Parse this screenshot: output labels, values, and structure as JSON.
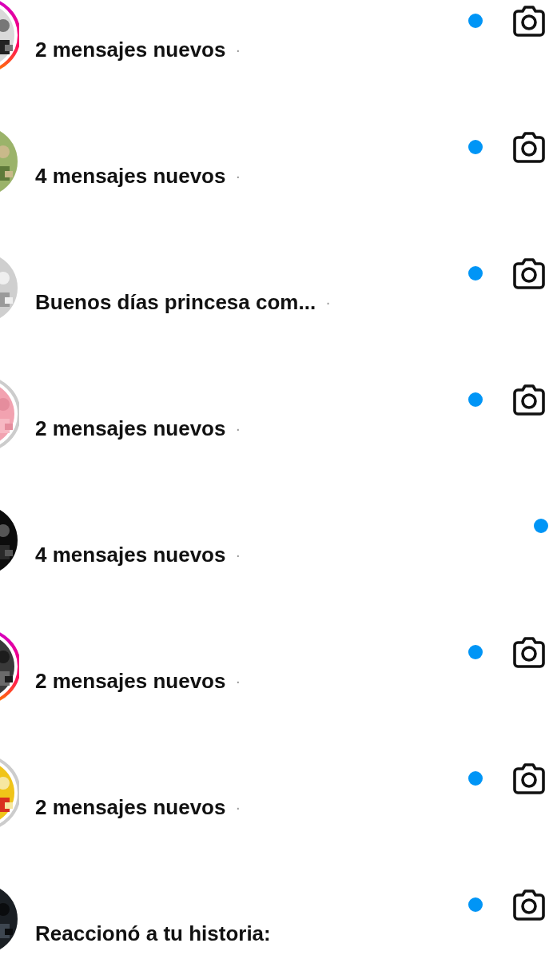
{
  "chats": [
    {
      "story_ring": true,
      "story_seen": false,
      "preview": "2 mensajes nuevos",
      "separator": "·",
      "unread": true,
      "camera": true
    },
    {
      "story_ring": false,
      "preview": "4 mensajes nuevos",
      "separator": "·",
      "unread": true,
      "camera": true
    },
    {
      "story_ring": false,
      "preview": "Buenos días princesa com...",
      "separator": "·",
      "unread": true,
      "camera": true
    },
    {
      "story_ring": true,
      "story_seen": true,
      "preview": "2 mensajes nuevos",
      "separator": "·",
      "unread": true,
      "camera": true
    },
    {
      "story_ring": false,
      "preview": "4 mensajes nuevos",
      "separator": "·",
      "unread": true,
      "camera": false
    },
    {
      "story_ring": true,
      "story_seen": false,
      "preview": "2 mensajes nuevos",
      "separator": "·",
      "unread": true,
      "camera": true
    },
    {
      "story_ring": true,
      "story_seen": true,
      "preview": "2 mensajes nuevos",
      "separator": "·",
      "unread": true,
      "camera": true
    },
    {
      "story_ring": false,
      "preview": "Reaccionó a tu historia:",
      "unread": true,
      "camera": true
    }
  ]
}
